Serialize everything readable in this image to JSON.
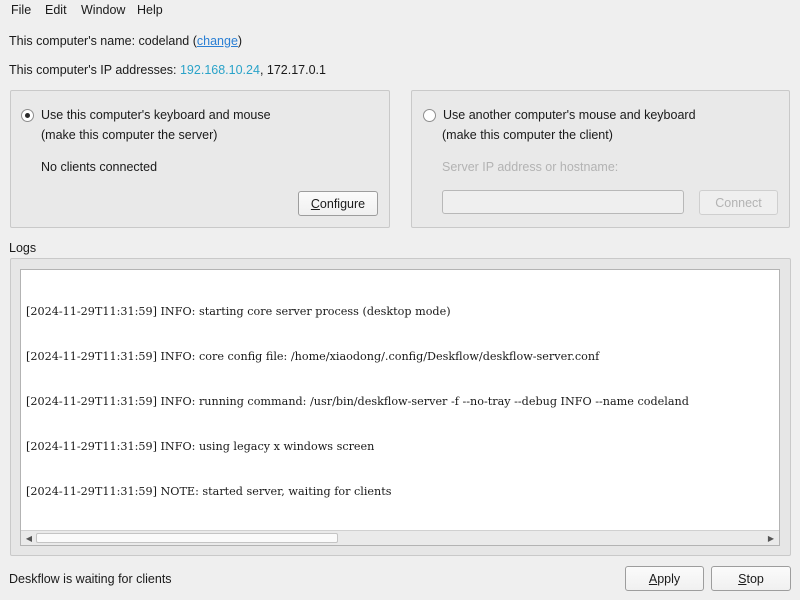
{
  "menubar": {
    "items": [
      "File",
      "Edit",
      "Window",
      "Help"
    ]
  },
  "info": {
    "name_prefix": "This computer's name: codeland (",
    "change_link": "change",
    "name_suffix": ")",
    "ip_prefix": "This computer's IP addresses: ",
    "ip_primary": "192.168.10.24",
    "ip_rest": ", 172.17.0.1"
  },
  "server": {
    "radio_label": "Use this computer's keyboard and mouse",
    "radio_checked": true,
    "subtitle": "(make this computer the server)",
    "status": "No clients connected",
    "configure_mnemonic": "C",
    "configure_rest": "onfigure"
  },
  "client": {
    "radio_label": "Use another computer's mouse and keyboard",
    "radio_checked": false,
    "subtitle": "(make this computer the client)",
    "server_ip_label": "Server IP address or hostname:",
    "server_ip_value": "",
    "connect_label": "Connect"
  },
  "logs": {
    "title": "Logs",
    "lines": [
      "[2024-11-29T11:31:59] INFO: starting core server process (desktop mode)",
      "[2024-11-29T11:31:59] INFO: core config file: /home/xiaodong/.config/Deskflow/deskflow-server.conf",
      "[2024-11-29T11:31:59] INFO: running command: /usr/bin/deskflow-server -f --no-tray --debug INFO --name codeland",
      "[2024-11-29T11:31:59] INFO: using legacy x windows screen",
      "[2024-11-29T11:31:59] NOTE: started server, waiting for clients"
    ]
  },
  "footer": {
    "status": "Deskflow is waiting for clients",
    "apply_mnemonic": "A",
    "apply_rest": "pply",
    "stop_mnemonic": "S",
    "stop_rest": "top"
  },
  "colors": {
    "link": "#2a7fd4",
    "ip_highlight": "#2aa3c9",
    "window_bg": "#efefef"
  },
  "icons": {
    "scroll_left": "scroll-left-arrow-icon",
    "scroll_right": "scroll-right-arrow-icon"
  }
}
